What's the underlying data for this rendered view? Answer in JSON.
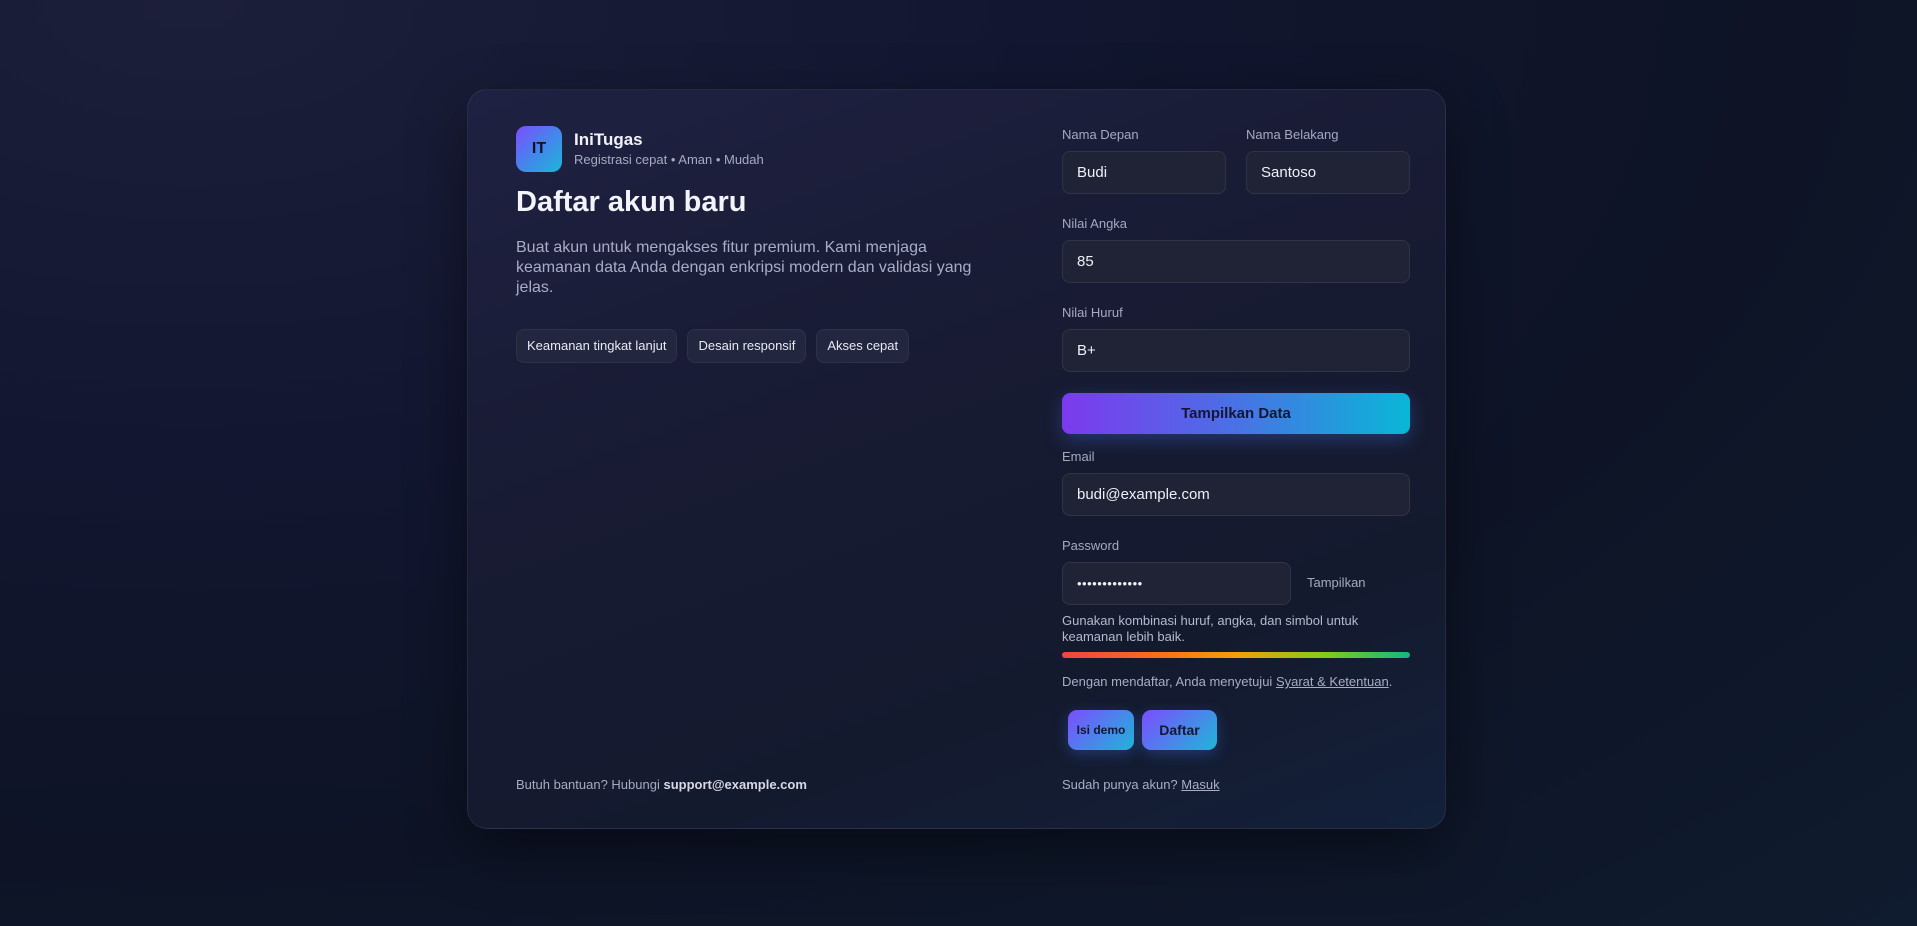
{
  "brand": {
    "logo_text": "IT",
    "name": "IniTugas",
    "tagline": "Registrasi cepat • Aman • Mudah"
  },
  "intro": {
    "title": "Daftar akun baru",
    "description": "Buat akun untuk mengakses fitur premium. Kami menjaga keamanan data Anda dengan enkripsi modern dan validasi yang jelas.",
    "chips": [
      "Keamanan tingkat lanjut",
      "Desain responsif",
      "Akses cepat"
    ]
  },
  "help": {
    "prefix": "Butuh bantuan? Hubungi ",
    "email": "support@example.com"
  },
  "form": {
    "first_name": {
      "label": "Nama Depan",
      "value": "Budi"
    },
    "last_name": {
      "label": "Nama Belakang",
      "value": "Santoso"
    },
    "numeric_grade": {
      "label": "Nilai Angka",
      "value": "85"
    },
    "letter_grade": {
      "label": "Nilai Huruf",
      "value": "B+"
    },
    "show_data_button": "Tampilkan Data",
    "email": {
      "label": "Email",
      "value": "budi@example.com"
    },
    "password": {
      "label": "Password",
      "value": "budi12345678!",
      "toggle": "Tampilkan"
    },
    "hint": "Gunakan kombinasi huruf, angka, dan simbol untuk keamanan lebih baik.",
    "terms_prefix": "Dengan mendaftar, Anda menyetujui ",
    "terms_link": "Syarat & Ketentuan",
    "terms_suffix": ".",
    "demo_button": "Isi demo",
    "submit_button": "Daftar",
    "login_prefix": "Sudah punya akun? ",
    "login_link": "Masuk"
  },
  "colors": {
    "accent_start": "#7c3aed",
    "accent_end": "#09b7d6",
    "background": "#0e1426"
  }
}
